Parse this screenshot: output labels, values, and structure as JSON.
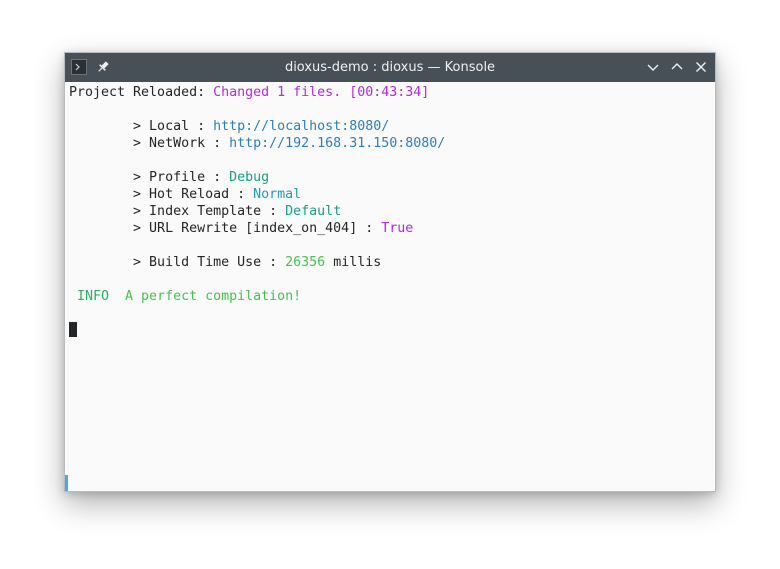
{
  "window": {
    "title": "dioxus-demo : dioxus — Konsole"
  },
  "icons": {
    "app": "terminal-app-icon",
    "pin": "pin-icon",
    "minimize": "chevron-down-icon",
    "maximize": "chevron-up-icon",
    "close": "close-icon"
  },
  "terminal": {
    "reload_prefix": "Project Reloaded: ",
    "reload_message": "Changed 1 files. [00:43:34]",
    "local_label": "        > Local : ",
    "local_url": "http://localhost:8080/",
    "network_label": "        > NetWork : ",
    "network_url": "http://192.168.31.150:8080/",
    "profile_label": "        > Profile : ",
    "profile_value": "Debug",
    "hot_reload_label": "        > Hot Reload : ",
    "hot_reload_value": "Normal",
    "index_template_label": "        > Index Template : ",
    "index_template_value": "Default",
    "url_rewrite_label": "        > URL Rewrite [index_on_404] : ",
    "url_rewrite_value": "True",
    "build_time_label": "        > Build Time Use : ",
    "build_time_value": "26356",
    "build_time_unit": " millis",
    "info_level": " INFO",
    "info_message": "  A perfect compilation!"
  }
}
